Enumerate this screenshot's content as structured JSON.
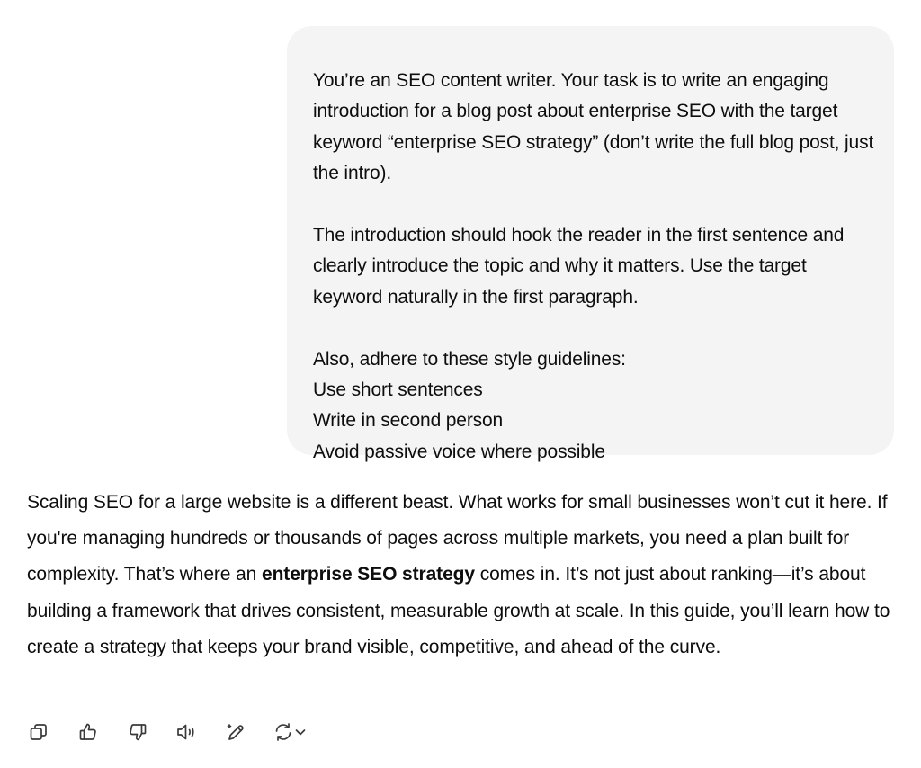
{
  "user_message": {
    "paragraph1": "You’re an SEO content writer. Your task is to write an engaging introduction for a blog post about enterprise SEO with the target keyword “enterprise SEO strategy” (don’t write the full blog post, just the intro).",
    "paragraph2": "The introduction should hook the reader in the first sentence and clearly introduce the topic and why it matters. Use the target keyword naturally in the first paragraph.",
    "guidelines_intro": "Also, adhere to these style guidelines:",
    "guidelines": [
      "Use short sentences",
      "Write in second person",
      "Avoid passive voice where possible"
    ]
  },
  "assistant_message": {
    "before_bold": "Scaling SEO for a large website is a different beast. What works for small businesses won’t cut it here. If you're managing hundreds or thousands of pages across multiple markets, you need a plan built for complexity. That’s where an ",
    "bold": "enterprise SEO strategy",
    "after_bold": " comes in. It’s not just about ranking—it’s about building a framework that drives consistent, measurable growth at scale. In this guide, you’ll learn how to create a strategy that keeps your brand visible, competitive, and ahead of the curve."
  },
  "actions": {
    "icons": [
      "copy-icon",
      "thumbs-up-icon",
      "thumbs-down-icon",
      "read-aloud-icon",
      "edit-icon",
      "regenerate-icon",
      "chevron-down-icon"
    ]
  },
  "colors": {
    "bubble_bg": "#f4f4f4",
    "text": "#0d0d0d",
    "icon": "#3a3a3a"
  }
}
